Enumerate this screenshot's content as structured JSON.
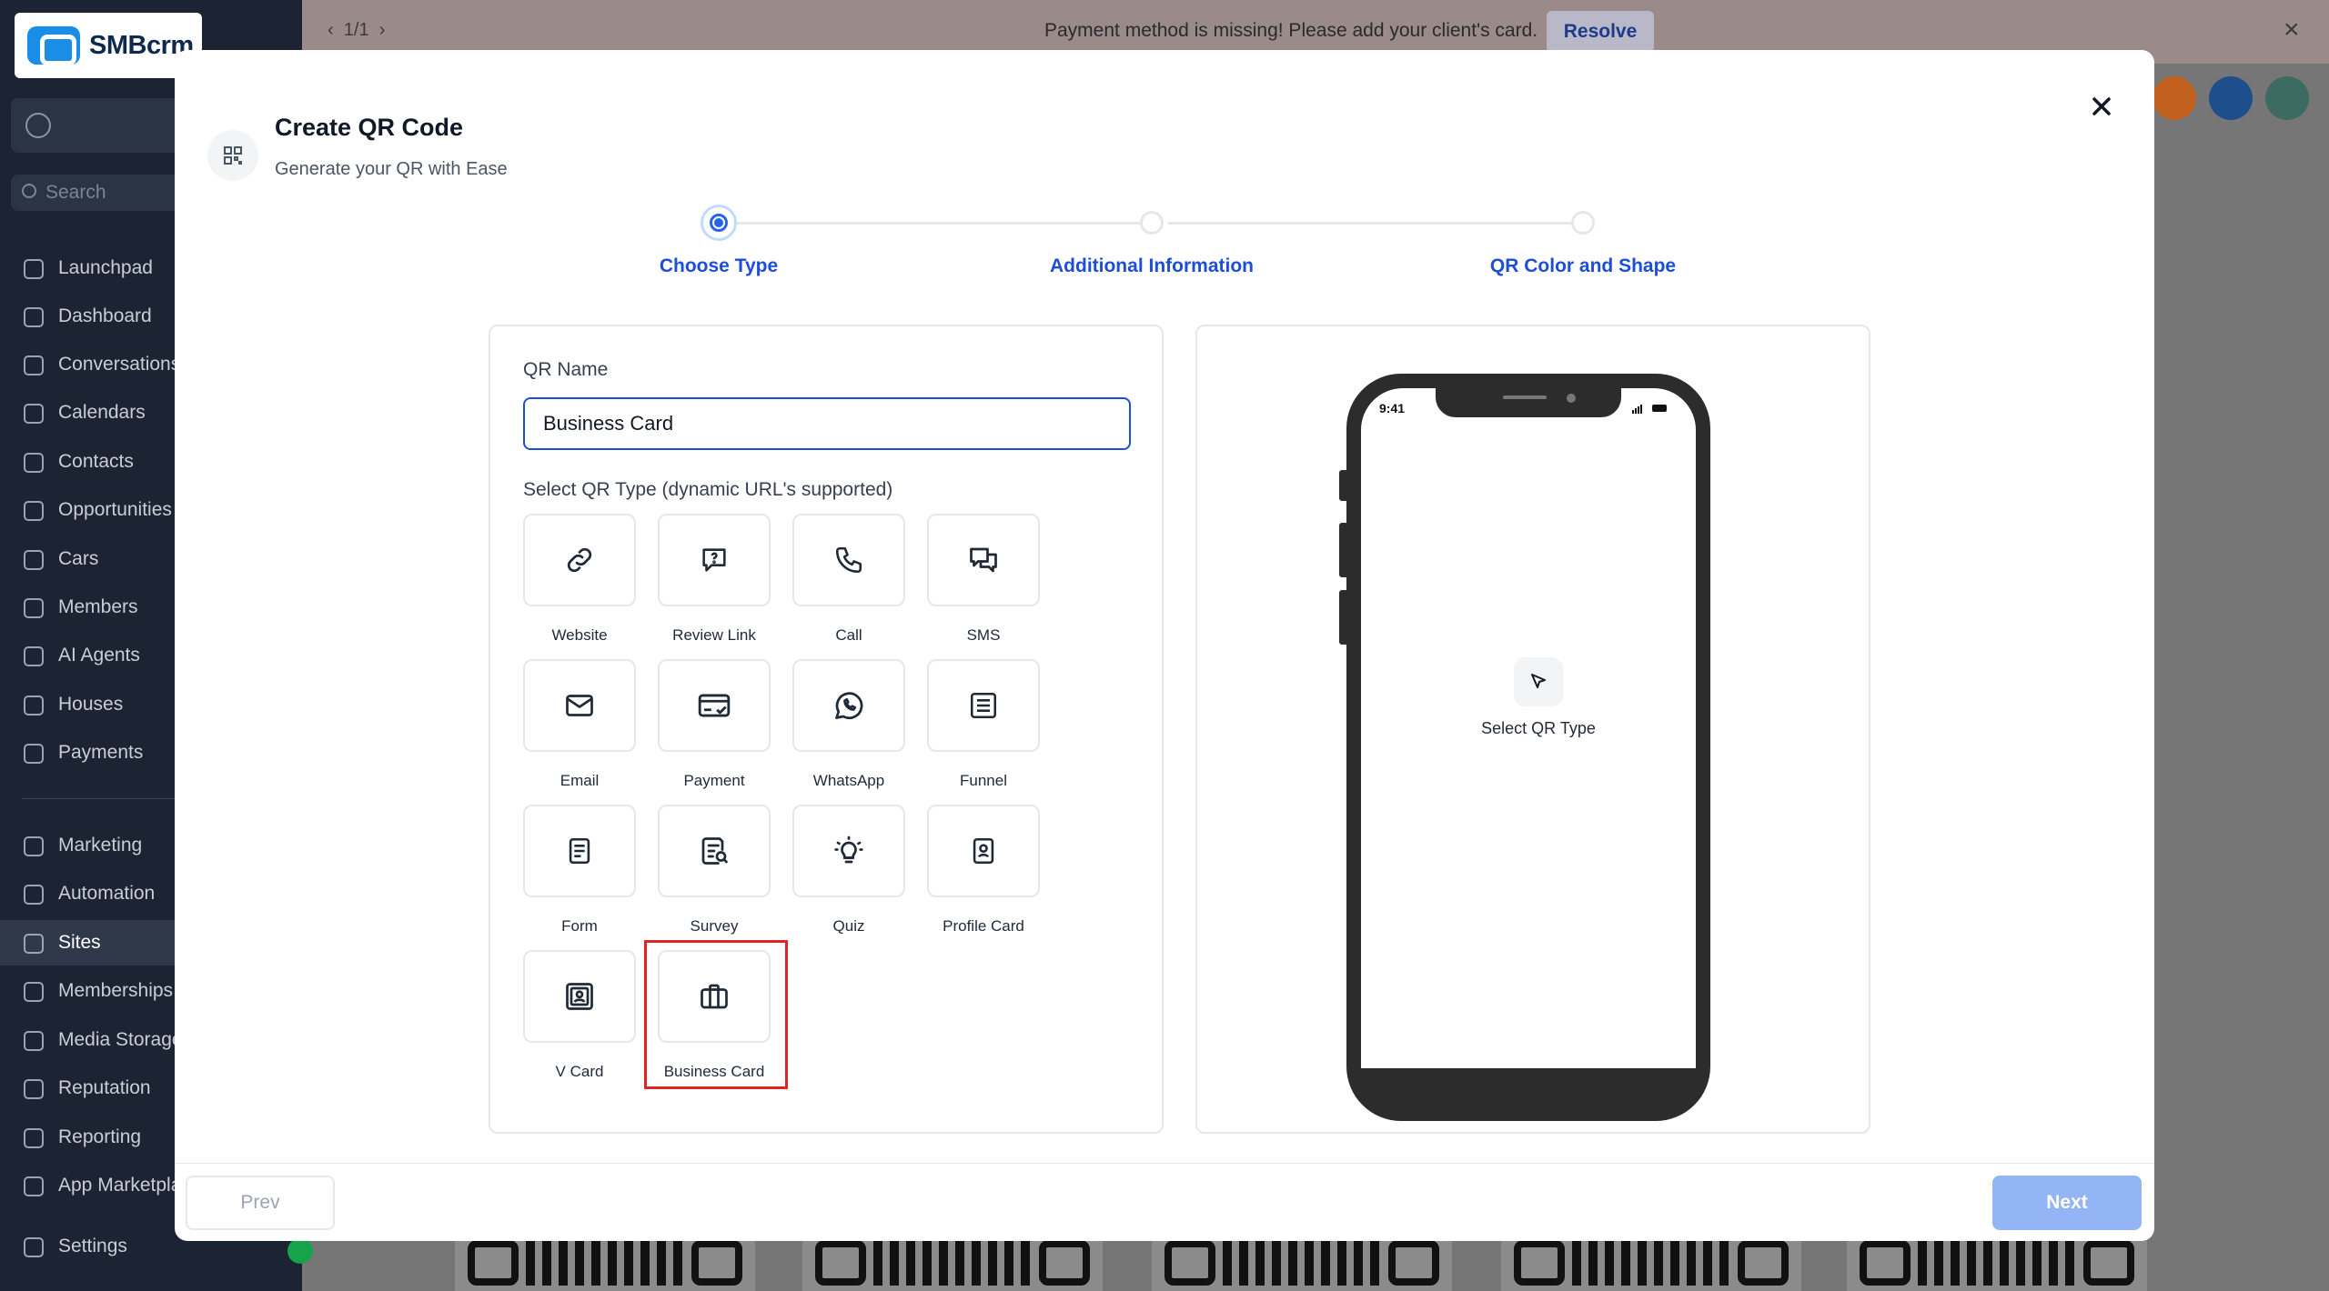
{
  "app": {
    "logo_text": "SMBcrm"
  },
  "sidebar": {
    "search_placeholder": "Search",
    "items": [
      {
        "label": "Launchpad",
        "icon": "rocket-icon"
      },
      {
        "label": "Dashboard",
        "icon": "grid-icon"
      },
      {
        "label": "Conversations",
        "icon": "chat-icon"
      },
      {
        "label": "Calendars",
        "icon": "calendar-icon"
      },
      {
        "label": "Contacts",
        "icon": "contacts-icon"
      },
      {
        "label": "Opportunities",
        "icon": "funnel-icon"
      },
      {
        "label": "Cars",
        "icon": "box-icon"
      },
      {
        "label": "Members",
        "icon": "box-icon"
      },
      {
        "label": "AI Agents",
        "icon": "sparkle-icon"
      },
      {
        "label": "Houses",
        "icon": "home-icon"
      },
      {
        "label": "Payments",
        "icon": "receipt-icon"
      }
    ],
    "items2": [
      {
        "label": "Marketing",
        "icon": "send-icon"
      },
      {
        "label": "Automation",
        "icon": "automation-icon"
      },
      {
        "label": "Sites",
        "icon": "globe-icon",
        "active": true
      },
      {
        "label": "Memberships",
        "icon": "badge-icon"
      },
      {
        "label": "Media Storage",
        "icon": "image-icon"
      },
      {
        "label": "Reputation",
        "icon": "star-icon"
      },
      {
        "label": "Reporting",
        "icon": "chart-icon"
      },
      {
        "label": "App Marketplace",
        "icon": "apps-icon"
      }
    ],
    "settings_label": "Settings"
  },
  "banner": {
    "pager": "1/1",
    "message": "Payment method is missing! Please add your client's card.",
    "resolve_label": "Resolve"
  },
  "modal": {
    "title": "Create QR Code",
    "subtitle": "Generate your QR with Ease",
    "steps": [
      {
        "label": "Choose Type",
        "active": true
      },
      {
        "label": "Additional Information",
        "active": false
      },
      {
        "label": "QR Color and Shape",
        "active": false
      }
    ],
    "qr_name_label": "QR Name",
    "qr_name_value": "Business Card",
    "qr_type_label": "Select QR Type (dynamic URL's supported)",
    "qr_types": [
      {
        "label": "Website",
        "icon": "link-icon"
      },
      {
        "label": "Review Link",
        "icon": "review-icon"
      },
      {
        "label": "Call",
        "icon": "phone-icon"
      },
      {
        "label": "SMS",
        "icon": "sms-icon"
      },
      {
        "label": "Email",
        "icon": "mail-icon"
      },
      {
        "label": "Payment",
        "icon": "card-icon"
      },
      {
        "label": "WhatsApp",
        "icon": "whatsapp-icon"
      },
      {
        "label": "Funnel",
        "icon": "funnel-page-icon"
      },
      {
        "label": "Form",
        "icon": "form-icon"
      },
      {
        "label": "Survey",
        "icon": "survey-icon"
      },
      {
        "label": "Quiz",
        "icon": "bulb-icon"
      },
      {
        "label": "Profile Card",
        "icon": "profile-card-icon"
      },
      {
        "label": "V Card",
        "icon": "vcard-icon"
      },
      {
        "label": "Business Card",
        "icon": "briefcase-icon",
        "selected": true
      }
    ],
    "preview": {
      "time": "9:41",
      "text": "Select QR Type"
    },
    "prev_label": "Prev",
    "next_label": "Next"
  },
  "colors": {
    "accent": "#1d4ed8",
    "highlight": "#dc2626",
    "next_disabled": "#93b4f5"
  }
}
